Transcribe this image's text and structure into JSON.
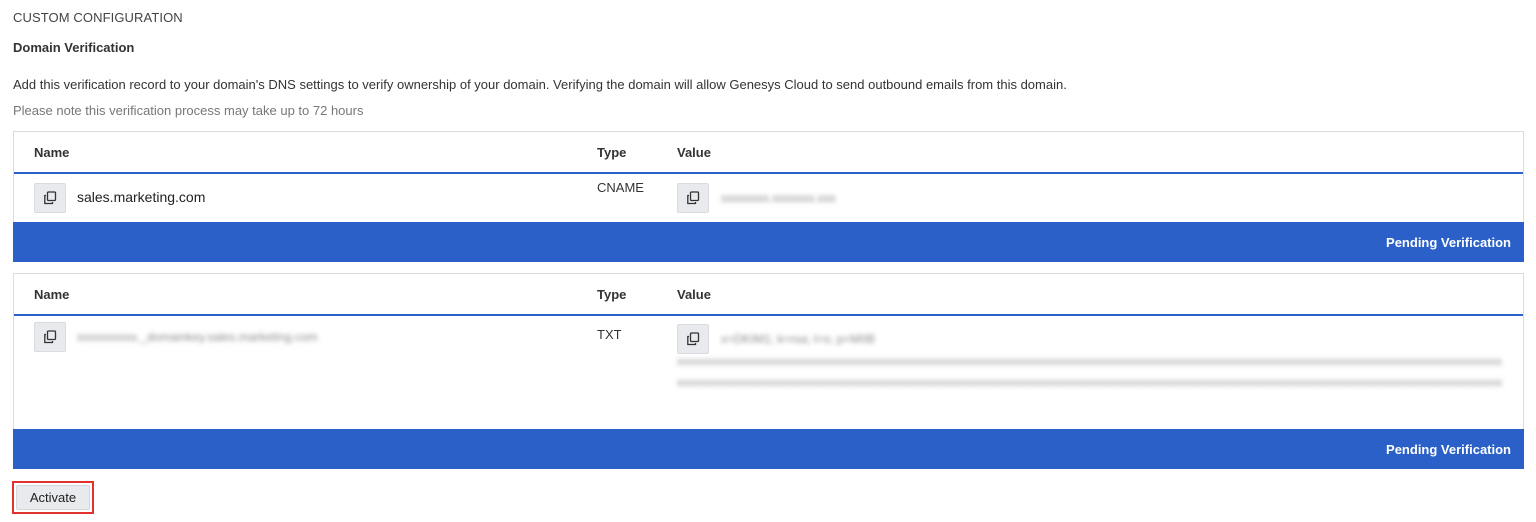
{
  "section_label": "CUSTOM CONFIGURATION",
  "section_title": "Domain Verification",
  "description": "Add this verification record to your domain's DNS settings to verify ownership of your domain. Verifying the domain will allow Genesys Cloud to send outbound emails from this domain.",
  "note": "Please note this verification process may take up to 72 hours",
  "columns": {
    "name": "Name",
    "type": "Type",
    "value": "Value"
  },
  "records": [
    {
      "name": "sales.marketing.com",
      "type": "CNAME",
      "value": "xxxxxxxx.xxxxxxx.xxx",
      "status": "Pending Verification"
    },
    {
      "name": "xxxxxxxxxx._domainkey.sales.marketing.com",
      "type": "TXT",
      "value_line1": "x=DKIM1; k=rsa; t=s; p=MIIB",
      "value_rest": "xxxxxxxxxxxxxxxxxxxxxxxxxxxxxxxxxxxxxxxxxxxxxxxxxxxxxxxxxxxxxxxxxxxxxxxxxxxxxxxxxxxxxxxxxxxxxxxxxxxxxxxxxxxxxxxxxxxxxxxxxxxxxxxxxxxxxxxxxxxxxxxxxxxxxxxxxxxxxxxxxxxxxxxxxxxxxxxxxxxxxxxxxxxxxxxxxxxxxxxxxxxxxxxxxxxxxxxxxxxxxxxxxxxxxxxxxxxxxxxxxxxxxxxxxxxxxxxxxxxxxxxxxxxxxxxxxxxxxxxxxxxxxxxxxxxxxxxxxxxx",
      "status": "Pending Verification"
    }
  ],
  "activate_label": "Activate",
  "icons": {
    "copy": "copy-icon"
  },
  "colors": {
    "accent": "#2a60c8",
    "highlight": "#e0332e"
  }
}
